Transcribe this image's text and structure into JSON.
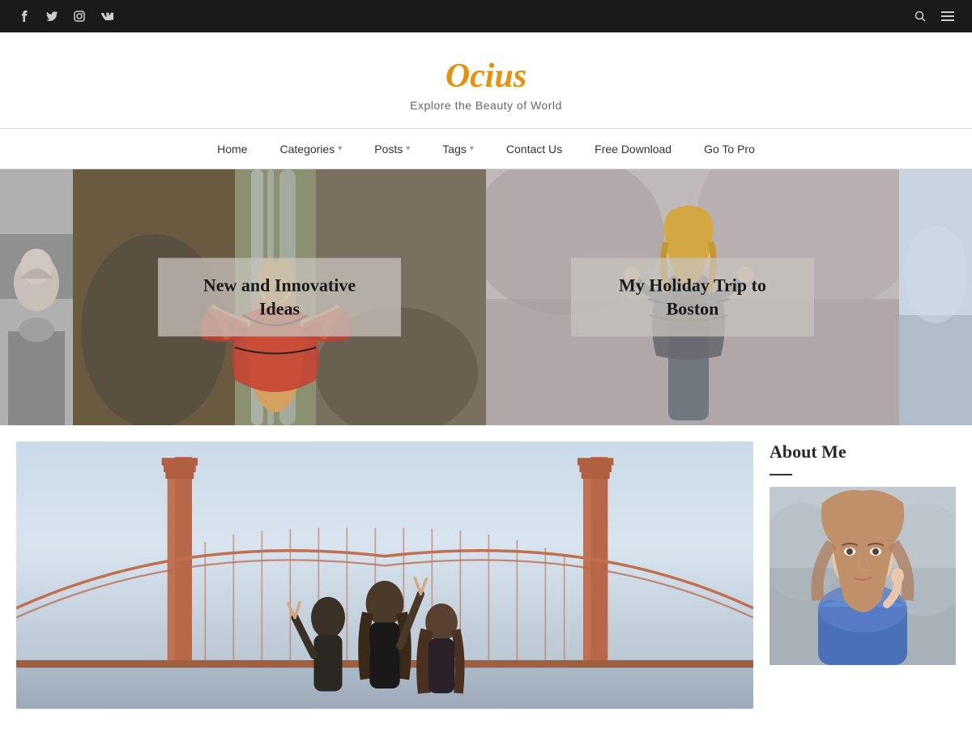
{
  "topbar": {
    "social": [
      {
        "name": "facebook",
        "icon": "f"
      },
      {
        "name": "twitter",
        "icon": "t"
      },
      {
        "name": "instagram",
        "icon": "ig"
      },
      {
        "name": "vk",
        "icon": "vk"
      }
    ]
  },
  "header": {
    "title": "Ocius",
    "tagline": "Explore the Beauty of World"
  },
  "nav": {
    "items": [
      {
        "label": "Home",
        "has_dropdown": false
      },
      {
        "label": "Categories",
        "has_dropdown": true
      },
      {
        "label": "Posts",
        "has_dropdown": true
      },
      {
        "label": "Tags",
        "has_dropdown": true
      },
      {
        "label": "Contact Us",
        "has_dropdown": false
      },
      {
        "label": "Free Download",
        "has_dropdown": false
      },
      {
        "label": "Go To Pro",
        "has_dropdown": false
      }
    ]
  },
  "hero": {
    "slides": [
      {
        "title": "New and Innovative Ideas"
      },
      {
        "title": "My Holiday Trip to Boston"
      }
    ]
  },
  "sidebar": {
    "about_me": {
      "title": "About Me",
      "underline": true
    }
  }
}
